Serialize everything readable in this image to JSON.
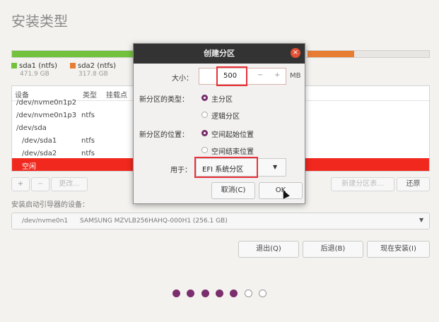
{
  "page": {
    "title": "安装类型"
  },
  "legend": [
    {
      "label": "sda1 (ntfs)",
      "size": "471.9 GB",
      "color": "#73c23e"
    },
    {
      "label": "sda2 (ntfs)",
      "size": "317.8 GB",
      "color": "#e77c33"
    }
  ],
  "table": {
    "headers": {
      "device": "设备",
      "type": "类型",
      "mount": "挂载点"
    },
    "rows": [
      {
        "device": "/dev/nvme0n1p2",
        "type": ""
      },
      {
        "device": "/dev/nvme0n1p3",
        "type": "ntfs"
      },
      {
        "device": "/dev/sda",
        "type": ""
      },
      {
        "device": "/dev/sda1",
        "type": "ntfs"
      },
      {
        "device": "/dev/sda2",
        "type": "ntfs"
      },
      {
        "device": "空闲",
        "type": ""
      }
    ]
  },
  "toolbar": {
    "add": "+",
    "remove": "−",
    "change": "更改...",
    "new_table": "新建分区表...",
    "revert": "还原"
  },
  "boot": {
    "label": "安装启动引导器的设备：",
    "device": "/dev/nvme0n1",
    "desc": "SAMSUNG MZVLB256HAHQ-000H1 (256.1 GB)"
  },
  "nav": {
    "quit": "退出(Q)",
    "back": "后退(B)",
    "install": "现在安装(I)"
  },
  "dialog": {
    "title": "创建分区",
    "close": "×",
    "size_label": "大小：",
    "size_value": "500",
    "size_unit": "MB",
    "type_label": "新分区的类型：",
    "type_primary": "主分区",
    "type_logical": "逻辑分区",
    "loc_label": "新分区的位置：",
    "loc_start": "空间起始位置",
    "loc_end": "空间结束位置",
    "use_label": "用于：",
    "use_value": "EFI 系统分区",
    "cancel": "取消(C)",
    "ok": "OK"
  },
  "progress": {
    "current_step": 5,
    "total_steps": 7
  }
}
